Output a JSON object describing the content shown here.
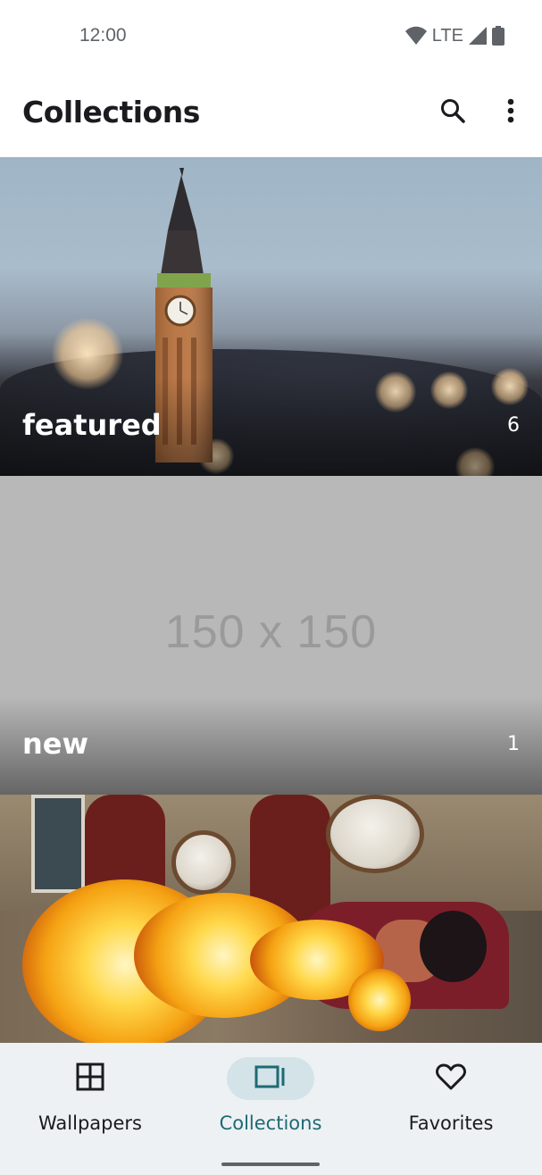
{
  "status_bar": {
    "time": "12:00",
    "network": "LTE",
    "icons": [
      "wifi-icon",
      "cellular-signal-icon",
      "battery-icon"
    ]
  },
  "app_bar": {
    "title": "Collections",
    "actions": [
      "search-icon",
      "more-vert-icon"
    ]
  },
  "collections": [
    {
      "name": "featured",
      "count": "6",
      "image": "big-ben-at-dusk"
    },
    {
      "name": "new",
      "count": "1",
      "image": "placeholder",
      "placeholder_text": "150 x 150"
    },
    {
      "name": "",
      "count": "",
      "image": "fire-breather-performer"
    }
  ],
  "nav": {
    "items": [
      {
        "label": "Wallpapers",
        "icon": "grid-icon",
        "active": false
      },
      {
        "label": "Collections",
        "icon": "collections-icon",
        "active": true
      },
      {
        "label": "Favorites",
        "icon": "heart-icon",
        "active": false
      }
    ]
  },
  "colors": {
    "accent": "#1e6a73",
    "nav_indicator": "#d3e3e7",
    "nav_background": "#edf1f4"
  }
}
